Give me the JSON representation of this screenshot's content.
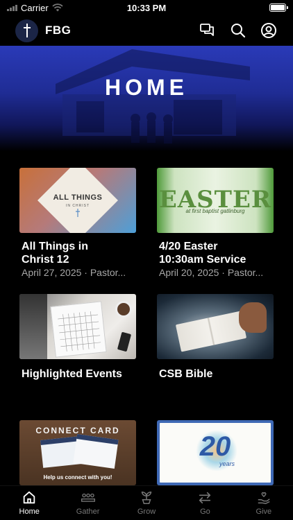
{
  "status": {
    "carrier": "Carrier",
    "time": "10:33 PM"
  },
  "header": {
    "title": "FBG",
    "icons": [
      "cross-logo-icon",
      "chat-icon",
      "search-icon",
      "profile-icon"
    ]
  },
  "hero": {
    "title": "HOME"
  },
  "cards": [
    {
      "title_line1": "All Things in",
      "title_line2": "Christ 12",
      "meta": "April 27, 2025 · Pastor...",
      "thumb_text": "ALL THINGS",
      "thumb_sub": "IN CHRIST"
    },
    {
      "title_line1": "4/20 Easter",
      "title_line2": "10:30am Service",
      "meta": "April 20, 2025 · Pastor...",
      "thumb_text": "EASTER",
      "thumb_sub": "at first baptist gatlinburg"
    },
    {
      "title_line1": "Highlighted Events"
    },
    {
      "title_line1": "CSB Bible"
    },
    {
      "thumb_text": "CONNECT CARD",
      "thumb_sub": "Help us connect with you!"
    },
    {
      "thumb_text": "20",
      "thumb_sub": "years"
    }
  ],
  "tabs": [
    {
      "label": "Home",
      "icon": "home-icon",
      "active": true
    },
    {
      "label": "Gather",
      "icon": "people-icon",
      "active": false
    },
    {
      "label": "Grow",
      "icon": "plant-icon",
      "active": false
    },
    {
      "label": "Go",
      "icon": "arrows-icon",
      "active": false
    },
    {
      "label": "Give",
      "icon": "give-hand-icon",
      "active": false
    }
  ],
  "colors": {
    "hero_top": "#2a3ab8",
    "background": "#000000",
    "muted_text": "#a7a7a7",
    "tab_inactive": "#777777"
  }
}
